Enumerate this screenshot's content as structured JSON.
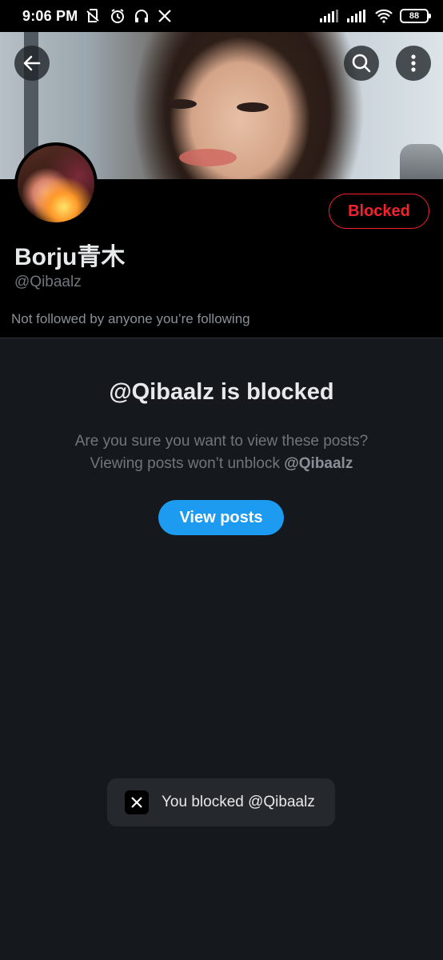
{
  "status_bar": {
    "time": "9:06 PM",
    "battery": "88"
  },
  "profile": {
    "display_name": "Borju青木",
    "handle": "@Qibaalz",
    "followed_by_text": "Not followed by anyone you’re following",
    "blocked_button_label": "Blocked"
  },
  "blocked_notice": {
    "title": "@Qibaalz is blocked",
    "line1": "Are you sure you want to view these posts?",
    "line2_prefix": "Viewing posts won’t unblock ",
    "line2_handle": "@Qibaalz",
    "view_posts_label": "View posts"
  },
  "toast": {
    "message": "You blocked @Qibaalz"
  },
  "icons": {
    "back": "arrow-left-icon",
    "search": "search-icon",
    "more": "more-vertical-icon",
    "toast_logo": "x-logo-icon"
  },
  "colors": {
    "blocked_red": "#f4212e",
    "accent_blue": "#1d9bf0",
    "background": "#15181c"
  }
}
